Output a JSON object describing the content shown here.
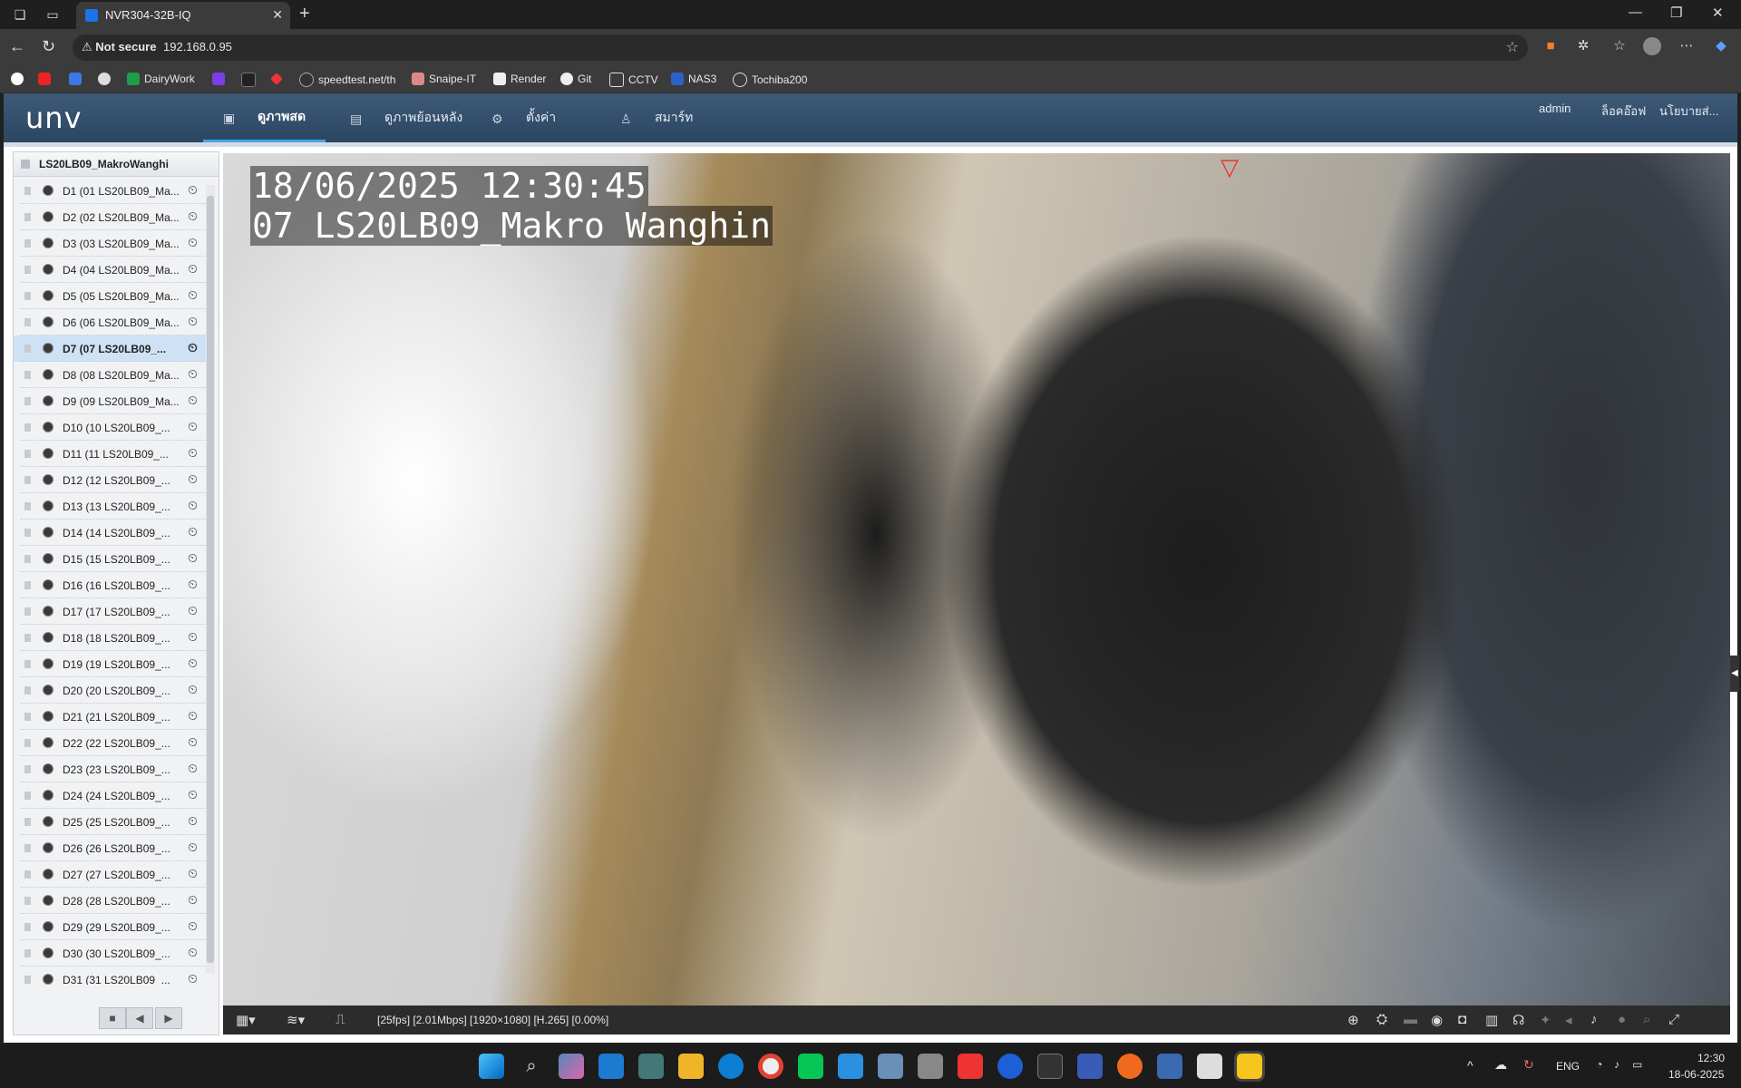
{
  "browser": {
    "tab_title": "NVR304-32B-IQ",
    "address_security": "Not secure",
    "address_url": "192.168.0.95",
    "bookmarks": [
      "DairyWork",
      "speedtest.net/th",
      "Snaipe-IT",
      "Render",
      "Git",
      "CCTV",
      "NAS3",
      "Tochiba200"
    ]
  },
  "app": {
    "logo": "unv",
    "nav": [
      {
        "label": "ดูภาพสด",
        "icon": "monitor-icon",
        "active": true
      },
      {
        "label": "ดูภาพย้อนหลัง",
        "icon": "playback-icon",
        "active": false
      },
      {
        "label": "ตั้งค่า",
        "icon": "gear-icon",
        "active": false
      },
      {
        "label": "สมาร์ท",
        "icon": "person-icon",
        "active": false
      }
    ],
    "header_right": {
      "user": "admin",
      "logout": "ล็อคอ๊อฟ",
      "policy": "นโยบายส่..."
    }
  },
  "sidebar": {
    "device_name": "LS20LB09_MakroWanghi",
    "selected_index": 6,
    "channels": [
      "D1 (01 LS20LB09_Ma...",
      "D2 (02 LS20LB09_Ma...",
      "D3 (03 LS20LB09_Ma...",
      "D4 (04 LS20LB09_Ma...",
      "D5 (05 LS20LB09_Ma...",
      "D6 (06 LS20LB09_Ma...",
      "D7 (07 LS20LB09_...",
      "D8 (08 LS20LB09_Ma...",
      "D9 (09 LS20LB09_Ma...",
      "D10 (10 LS20LB09_...",
      "D11 (11 LS20LB09_...",
      "D12 (12 LS20LB09_...",
      "D13 (13 LS20LB09_...",
      "D14 (14 LS20LB09_...",
      "D15 (15 LS20LB09_...",
      "D16 (16 LS20LB09_...",
      "D17 (17 LS20LB09_...",
      "D18 (18 LS20LB09_...",
      "D19 (19 LS20LB09_...",
      "D20 (20 LS20LB09_...",
      "D21 (21 LS20LB09_...",
      "D22 (22 LS20LB09_...",
      "D23 (23 LS20LB09_...",
      "D24 (24 LS20LB09_...",
      "D25 (25 LS20LB09_...",
      "D26 (26 LS20LB09_...",
      "D27 (27 LS20LB09_...",
      "D28 (28 LS20LB09_...",
      "D29 (29 LS20LB09_...",
      "D30 (30 LS20LB09_...",
      "D31 (31 LS20LB09_..."
    ]
  },
  "video": {
    "osd_datetime": "18/06/2025 12:30:45",
    "osd_camera": "07 LS20LB09_Makro Wanghin",
    "stream_status": "[25fps] [2.01Mbps] [1920×1080] [H.265] [0.00%]"
  },
  "taskbar": {
    "language": "ENG",
    "time": "12:30",
    "date": "18-06-2025"
  }
}
